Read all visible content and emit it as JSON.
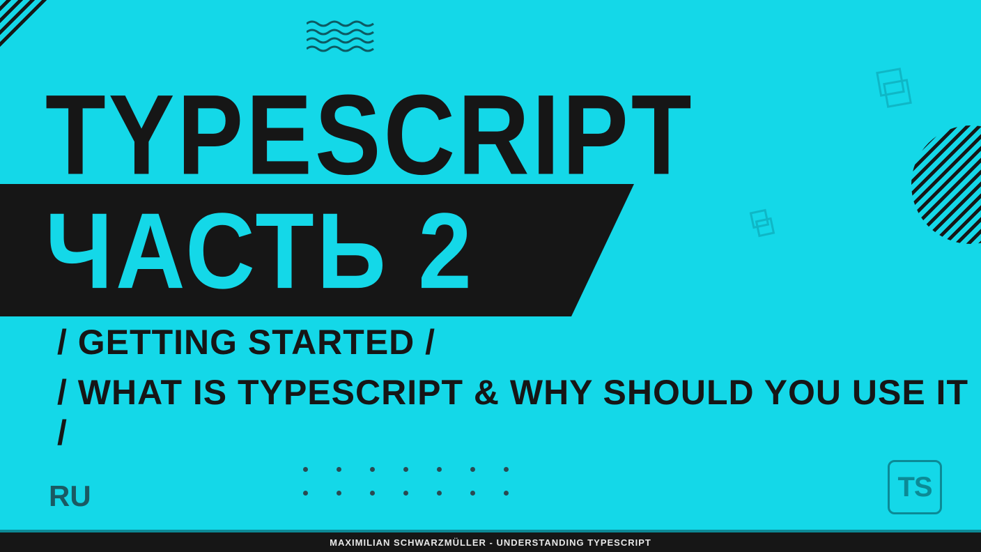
{
  "title": "TYPESCRIPT",
  "part": "ЧАСТЬ 2",
  "subtitle1": "/ GETTING STARTED /",
  "subtitle2": "/ WHAT IS TYPESCRIPT & WHY SHOULD YOU USE IT /",
  "language": "RU",
  "logo_text": "TS",
  "footer": "MAXIMILIAN SCHWARZMÜLLER - UNDERSTANDING TYPESCRIPT"
}
